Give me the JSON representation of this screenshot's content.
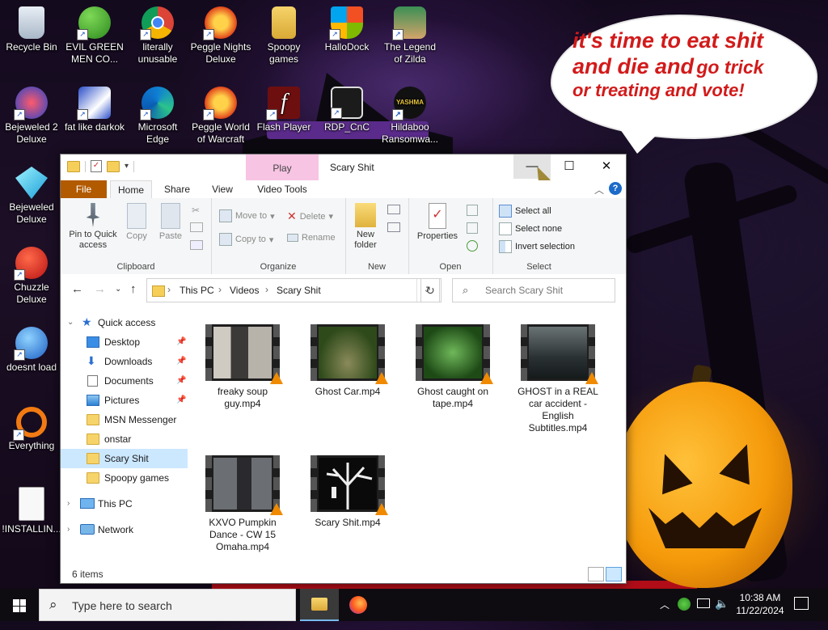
{
  "desktop": {
    "speech_bubble": {
      "line1": "it's time to eat shit",
      "line2a": "and die and",
      "line2b": "go trick",
      "line3": "or treating and vote!"
    },
    "icons": [
      {
        "label": "Recycle Bin",
        "icon": "recycle-bin-icon",
        "shortcut": false
      },
      {
        "label": "EVIL GREEN MEN CO...",
        "icon": "msn-men-icon",
        "shortcut": true
      },
      {
        "label": "literally unusable",
        "icon": "chrome-icon",
        "shortcut": true
      },
      {
        "label": "Peggle Nights Deluxe",
        "icon": "peggle-icon",
        "shortcut": true
      },
      {
        "label": "Spoopy games",
        "icon": "folder-icon",
        "shortcut": false
      },
      {
        "label": "HalloDock",
        "icon": "windows-shield-icon",
        "shortcut": true
      },
      {
        "label": "The Legend of Zilda",
        "icon": "zilda-icon",
        "shortcut": true
      },
      {
        "label": "Bejeweled 2 Deluxe",
        "icon": "bejeweled2-icon",
        "shortcut": true
      },
      {
        "label": "fat like darkok",
        "icon": "mpl-icon",
        "shortcut": true
      },
      {
        "label": "Microsoft Edge",
        "icon": "edge-icon",
        "shortcut": true
      },
      {
        "label": "Peggle World of Warcraft",
        "icon": "peggle-icon",
        "shortcut": true
      },
      {
        "label": "Flash Player",
        "icon": "flash-icon",
        "shortcut": true
      },
      {
        "label": "RDP_CnC",
        "icon": "rdp-icon",
        "shortcut": true
      },
      {
        "label": "Hildaboo Ransomwa...",
        "icon": "yashma-icon",
        "shortcut": true
      },
      {
        "label": "Bejeweled Deluxe",
        "icon": "gem-icon",
        "shortcut": true
      },
      {
        "label": "Chuzzle Deluxe",
        "icon": "chuzzle-icon",
        "shortcut": true
      },
      {
        "label": "doesnt load",
        "icon": "thunderbird-icon",
        "shortcut": true
      },
      {
        "label": "Everything",
        "icon": "everything-icon",
        "shortcut": true
      },
      {
        "label": "!INSTALLIN...",
        "icon": "text-file-icon",
        "shortcut": false
      }
    ]
  },
  "window": {
    "title": "Scary Shit",
    "context_tab": "Play",
    "controls": {
      "minimize": "—",
      "maximize": "☐",
      "close": "✕"
    },
    "ribbon_tabs": [
      "File",
      "Home",
      "Share",
      "View",
      "Video Tools"
    ],
    "ribbon": {
      "clipboard": {
        "title": "Clipboard",
        "pin": "Pin to Quick access",
        "copy": "Copy",
        "paste": "Paste"
      },
      "organize": {
        "title": "Organize",
        "move_to": "Move to",
        "copy_to": "Copy to",
        "delete": "Delete",
        "rename": "Rename"
      },
      "new": {
        "title": "New",
        "new_folder": "New folder"
      },
      "open": {
        "title": "Open",
        "properties": "Properties"
      },
      "select": {
        "title": "Select",
        "select_all": "Select all",
        "select_none": "Select none",
        "invert": "Invert selection"
      }
    },
    "address": {
      "crumbs": [
        "This PC",
        "Videos",
        "Scary Shit"
      ],
      "search_placeholder": "Search Scary Shit"
    },
    "nav": {
      "quick_access": "Quick access",
      "pinned": [
        {
          "label": "Desktop",
          "icon": "desktop-folder-icon",
          "pinned": true
        },
        {
          "label": "Downloads",
          "icon": "downloads-folder-icon",
          "pinned": true
        },
        {
          "label": "Documents",
          "icon": "documents-folder-icon",
          "pinned": true
        },
        {
          "label": "Pictures",
          "icon": "pictures-folder-icon",
          "pinned": true
        }
      ],
      "recent": [
        "MSN Messenger",
        "onstar",
        "Scary Shit",
        "Spoopy games"
      ],
      "selected": "Scary Shit",
      "this_pc": "This PC",
      "network": "Network"
    },
    "files": [
      {
        "name": "freaky soup guy.mp4",
        "thumb_color": "#b9b4ac"
      },
      {
        "name": "Ghost Car.mp4",
        "thumb_color": "#4c6a2a"
      },
      {
        "name": "Ghost caught on tape.mp4",
        "thumb_color": "#2f6b25"
      },
      {
        "name": "GHOST in a REAL car accident - English Subtitles.mp4",
        "thumb_color": "#3d4a4d"
      },
      {
        "name": "KXVO Pumpkin Dance - CW 15 Omaha.mp4",
        "thumb_color": "#5c5f63"
      },
      {
        "name": "Scary Shit.mp4",
        "thumb_color": "#e8e8e8"
      }
    ],
    "status": "6 items"
  },
  "taskbar": {
    "search_placeholder": "Type here to search",
    "time": "10:38 AM",
    "date": "11/22/2024"
  },
  "colors": {
    "file_tab": "#b25a00",
    "context_tab": "#f7c4e3",
    "selection": "#cce8ff",
    "speech_text": "#d21a1a"
  }
}
